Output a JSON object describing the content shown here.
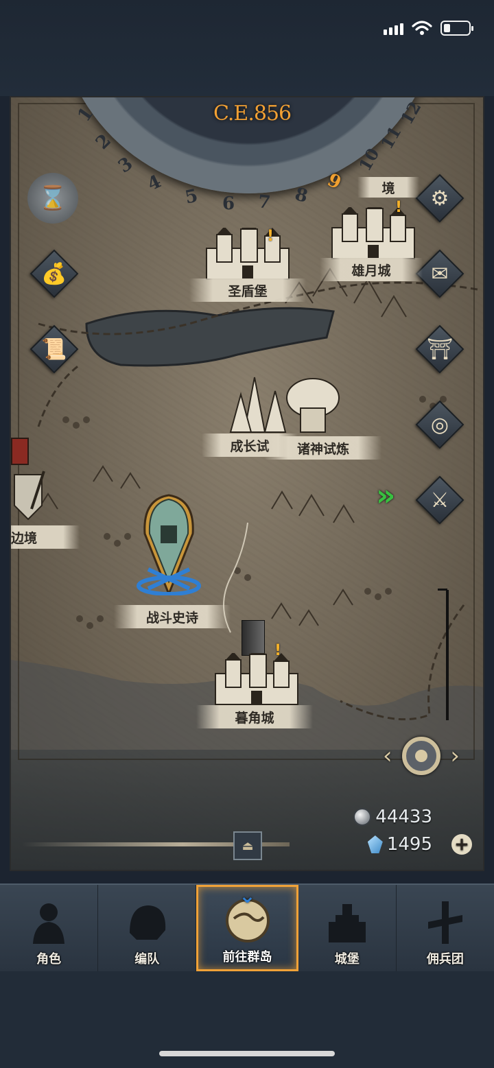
{
  "status_bar": {
    "icons": [
      "signal-icon",
      "wifi-icon",
      "battery-icon"
    ]
  },
  "map": {
    "year": "C.E.856",
    "dial_numbers": [
      "1",
      "2",
      "3",
      "4",
      "5",
      "6",
      "7",
      "8",
      "9",
      "10",
      "11",
      "12"
    ],
    "active_month": "9",
    "locations": [
      {
        "label": "圣盾堡"
      },
      {
        "label": "雄月城"
      },
      {
        "label": "境"
      },
      {
        "label": "成长试"
      },
      {
        "label": "诸神试炼"
      },
      {
        "label": "边境"
      },
      {
        "label": "战斗史诗"
      },
      {
        "label": "暮角城"
      }
    ]
  },
  "left_buttons": [
    "hourglass-icon",
    "money-bag-icon",
    "scroll-icon"
  ],
  "right_buttons": [
    "gear-icon",
    "mail-icon",
    "gate-icon",
    "coin-stack-icon",
    "warrior-icon"
  ],
  "currency": {
    "silver": "44433",
    "gems": "1495",
    "plus": "+"
  },
  "nav": {
    "tabs": [
      {
        "label": "角色",
        "icon": "knight-icon"
      },
      {
        "label": "编队",
        "icon": "helmet-icon"
      },
      {
        "label": "前往群岛",
        "icon": "compass-map-icon",
        "active": true
      },
      {
        "label": "城堡",
        "icon": "castle-icon"
      },
      {
        "label": "佣兵团",
        "icon": "mercenary-icon"
      }
    ]
  },
  "colors": {
    "accent": "#f0a238",
    "year": "#f2a033",
    "nav_bg": "#2a3440",
    "map_bg": "#8a7f6d"
  }
}
